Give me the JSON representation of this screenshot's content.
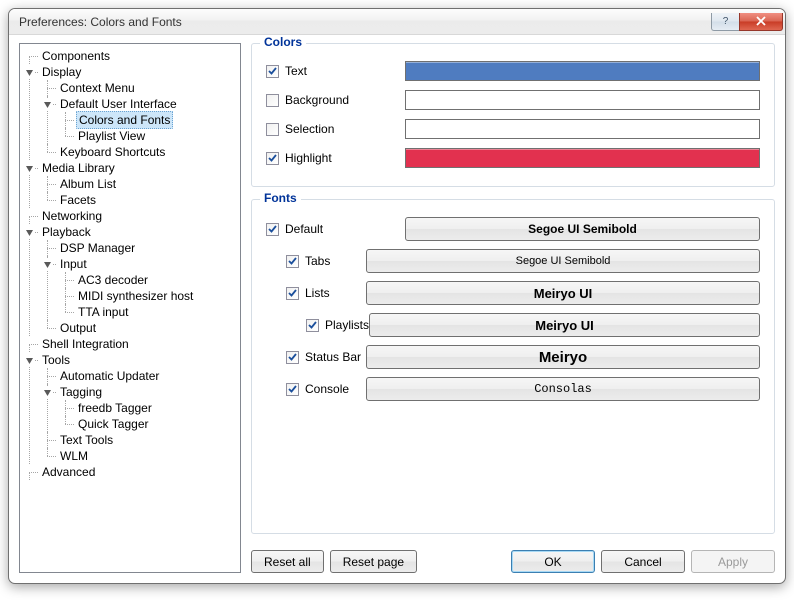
{
  "title": "Preferences: Colors and Fonts",
  "tree": {
    "components": "Components",
    "display": "Display",
    "context_menu": "Context Menu",
    "default_ui": "Default User Interface",
    "colors_fonts": "Colors and Fonts",
    "playlist_view": "Playlist View",
    "keyboard_shortcuts": "Keyboard Shortcuts",
    "media_library": "Media Library",
    "album_list": "Album List",
    "facets": "Facets",
    "networking": "Networking",
    "playback": "Playback",
    "dsp_manager": "DSP Manager",
    "input": "Input",
    "ac3": "AC3 decoder",
    "midi": "MIDI synthesizer host",
    "tta": "TTA input",
    "output": "Output",
    "shell_integration": "Shell Integration",
    "tools": "Tools",
    "auto_updater": "Automatic Updater",
    "tagging": "Tagging",
    "freedb": "freedb Tagger",
    "quick_tagger": "Quick Tagger",
    "text_tools": "Text Tools",
    "wlm": "WLM",
    "advanced": "Advanced"
  },
  "colors": {
    "heading": "Colors",
    "text": {
      "label": "Text",
      "checked": true,
      "color": "#4f7cc0"
    },
    "background": {
      "label": "Background",
      "checked": false,
      "color": "#ffffff"
    },
    "selection": {
      "label": "Selection",
      "checked": false,
      "color": "#ffffff"
    },
    "highlight": {
      "label": "Highlight",
      "checked": true,
      "color": "#e2314f"
    }
  },
  "fonts": {
    "heading": "Fonts",
    "default": {
      "label": "Default",
      "checked": true,
      "font": "Segoe UI Semibold"
    },
    "tabs": {
      "label": "Tabs",
      "checked": true,
      "font": "Segoe UI Semibold"
    },
    "lists": {
      "label": "Lists",
      "checked": true,
      "font": "Meiryo UI"
    },
    "playlists": {
      "label": "Playlists",
      "checked": true,
      "font": "Meiryo UI"
    },
    "status_bar": {
      "label": "Status Bar",
      "checked": true,
      "font": "Meiryo"
    },
    "console": {
      "label": "Console",
      "checked": true,
      "font": "Consolas"
    }
  },
  "buttons": {
    "reset_all": "Reset all",
    "reset_page": "Reset page",
    "ok": "OK",
    "cancel": "Cancel",
    "apply": "Apply"
  }
}
